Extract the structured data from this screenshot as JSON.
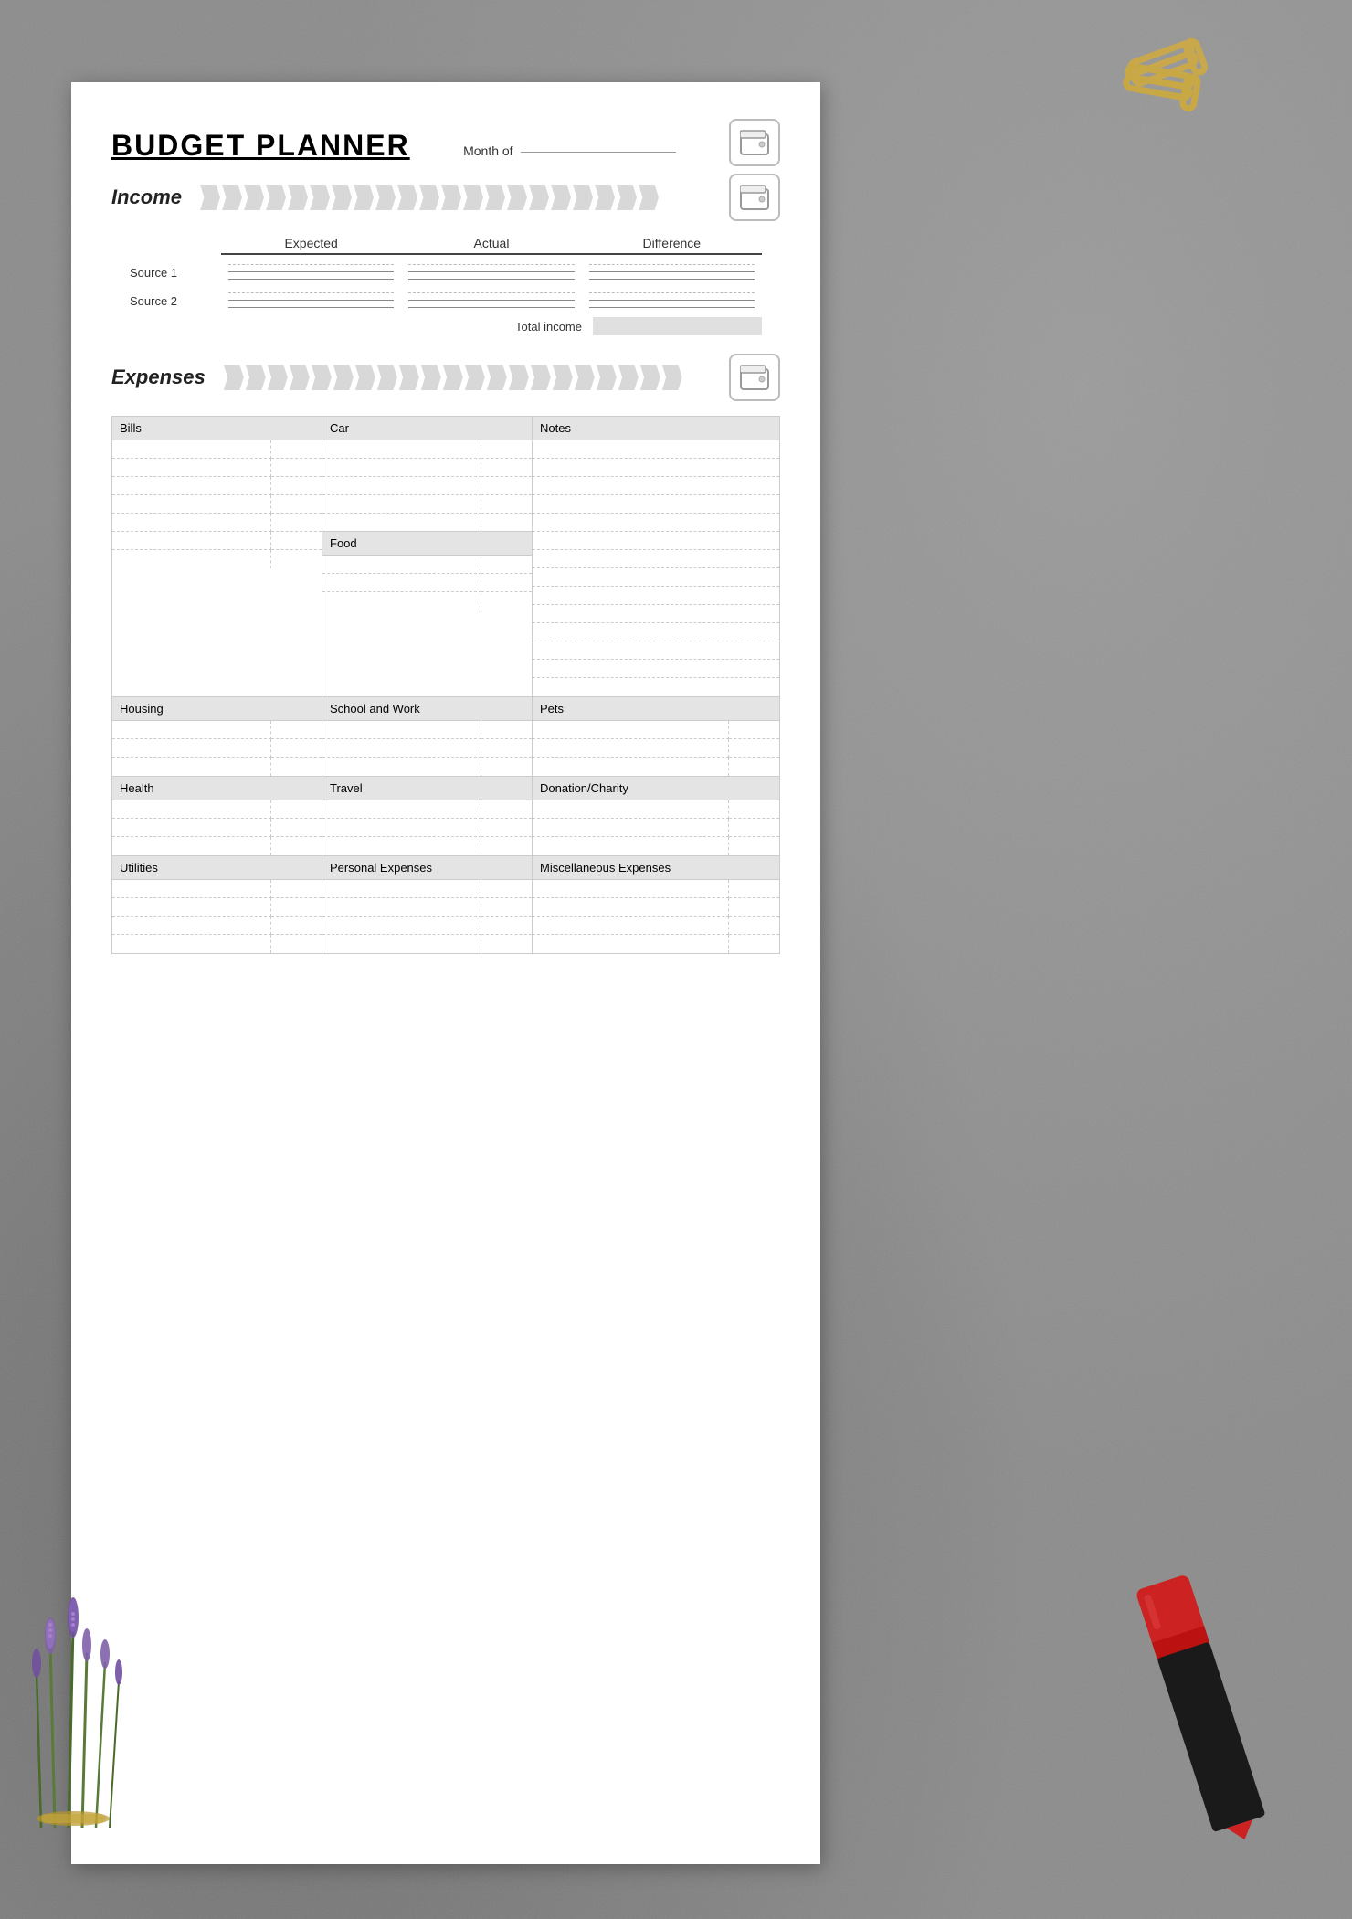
{
  "title": "BUDGET PLANNER",
  "month_of_label": "Month of",
  "sections": {
    "income": {
      "label": "Income",
      "columns": [
        "Expected",
        "Actual",
        "Difference"
      ],
      "sources": [
        "Source 1",
        "Source 2"
      ],
      "total_label": "Total income"
    },
    "expenses": {
      "label": "Expenses",
      "categories": {
        "bills": {
          "label": "Bills",
          "rows": 7
        },
        "car": {
          "label": "Car",
          "rows": 5
        },
        "notes": {
          "label": "Notes",
          "rows": 14
        },
        "food": {
          "label": "Food",
          "rows": 3
        },
        "housing": {
          "label": "Housing",
          "rows": 3
        },
        "school_work": {
          "label": "School and Work",
          "rows": 3
        },
        "pets": {
          "label": "Pets",
          "rows": 3
        },
        "health": {
          "label": "Health",
          "rows": 3
        },
        "travel": {
          "label": "Travel",
          "rows": 3
        },
        "donation": {
          "label": "Donation/Charity",
          "rows": 3
        },
        "utilities": {
          "label": "Utilities",
          "rows": 4
        },
        "personal": {
          "label": "Personal Expenses",
          "rows": 4
        },
        "miscellaneous": {
          "label": "Miscellaneous Expenses",
          "rows": 4
        }
      }
    }
  },
  "decorations": {
    "wallet_icon": "🗂",
    "paperclip_color": "#c8a84b"
  }
}
